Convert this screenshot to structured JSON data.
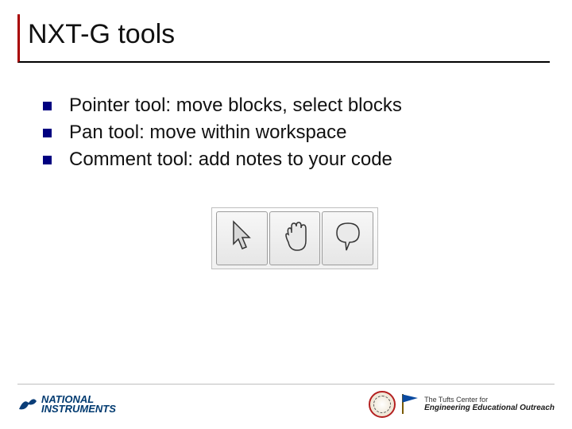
{
  "title": "NXT-G tools",
  "bullets": [
    "Pointer tool: move blocks, select blocks",
    "Pan tool: move within workspace",
    "Comment tool: add notes to your code"
  ],
  "toolbar": {
    "tools": [
      "pointer",
      "pan",
      "comment"
    ]
  },
  "footer": {
    "ni_line1": "NATIONAL",
    "ni_line2": "INSTRUMENTS",
    "tufts_line1": "The Tufts Center for",
    "tufts_line2": "Engineering Educational Outreach"
  }
}
